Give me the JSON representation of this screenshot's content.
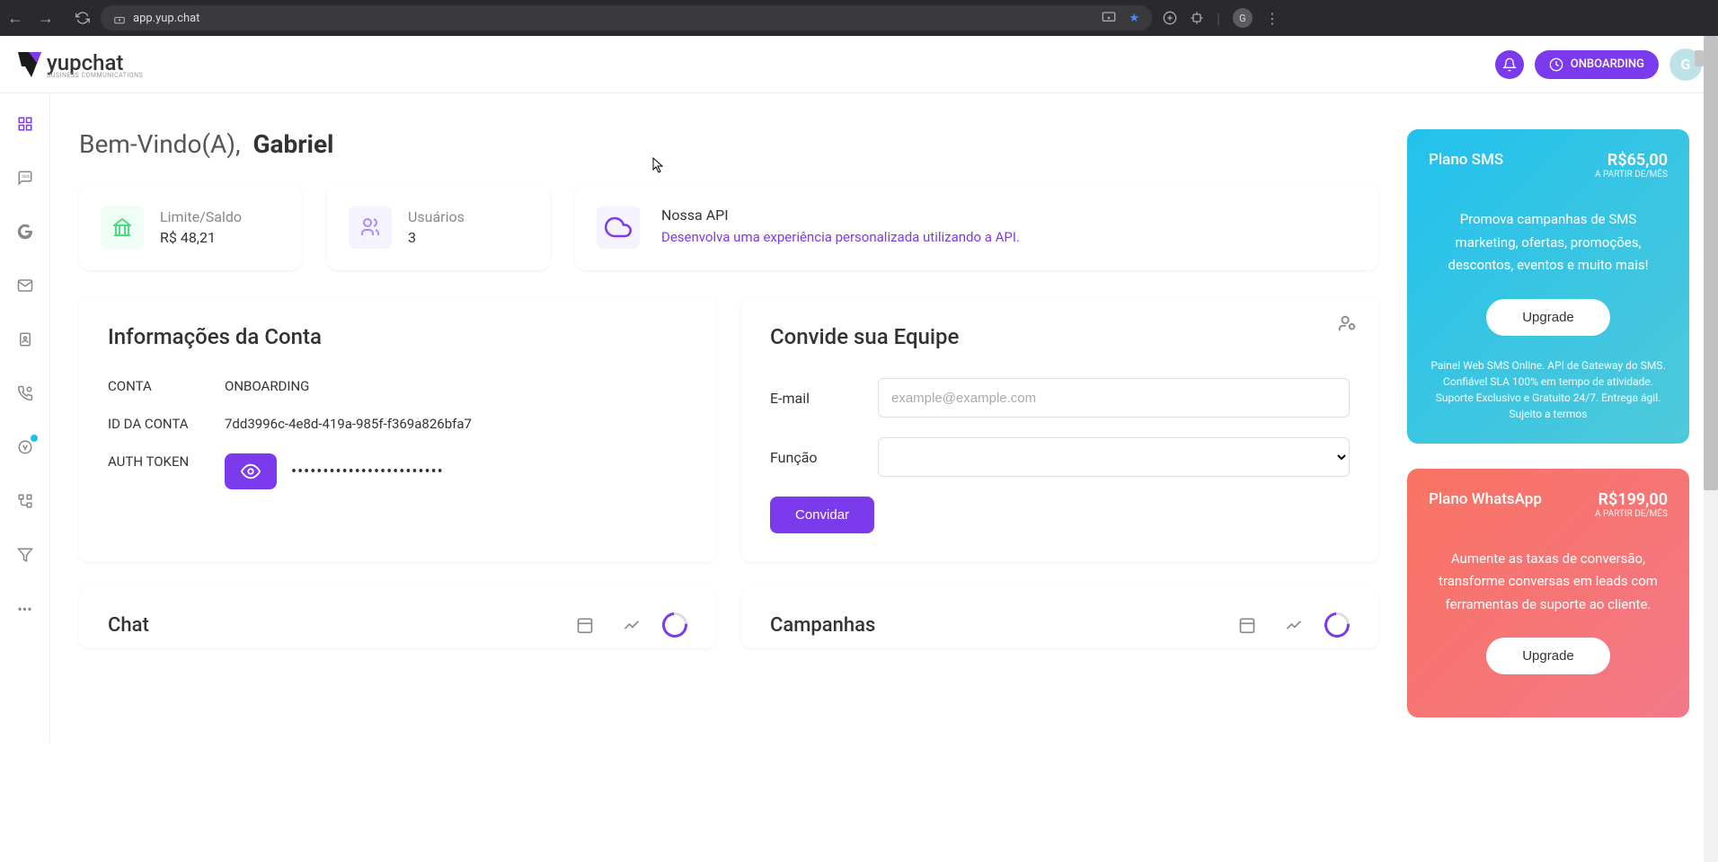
{
  "browser": {
    "url": "app.yup.chat",
    "profile_letter": "G"
  },
  "header": {
    "brand": "yupchat",
    "brand_sub": "BUSINESS COMMUNICATIONS",
    "onboarding_label": "ONBOARDING",
    "avatar_letter": "G"
  },
  "welcome": {
    "greeting": "Bem-Vindo(A),",
    "name": "Gabriel"
  },
  "stats": {
    "balance_label": "Limite/Saldo",
    "balance_value": "R$ 48,21",
    "users_label": "Usuários",
    "users_value": "3",
    "api_title": "Nossa API",
    "api_desc": "Desenvolva uma experiência personalizada utilizando a API."
  },
  "account_info": {
    "title": "Informações da Conta",
    "label_account": "CONTA",
    "value_account": "ONBOARDING",
    "label_id": "ID DA CONTA",
    "value_id": "7dd3996c-4e8d-419a-985f-f369a826bfa7",
    "label_token": "AUTH TOKEN",
    "value_token_masked": "••••••••••••••••••••••••"
  },
  "team": {
    "title": "Convide sua Equipe",
    "label_email": "E-mail",
    "placeholder_email": "example@example.com",
    "label_role": "Função",
    "invite_label": "Convidar"
  },
  "plans": {
    "sms": {
      "name": "Plano SMS",
      "price": "R$65,00",
      "per": "A PARTIR DE/MÊS",
      "desc": "Promova campanhas de SMS marketing, ofertas, promoções, descontos, eventos e muito mais!",
      "upgrade": "Upgrade",
      "fine": "Painel Web SMS Online. API de Gateway do SMS. Confiável SLA 100% em tempo de atividade. Suporte Exclusivo e Gratuito 24/7. Entrega ágil. Sujeito a termos"
    },
    "wa": {
      "name": "Plano WhatsApp",
      "price": "R$199,00",
      "per": "A PARTIR DE/MÊS",
      "desc": "Aumente as taxas de conversão, transforme conversas em leads com ferramentas de suporte ao cliente.",
      "upgrade": "Upgrade"
    }
  },
  "sections": {
    "chat_title": "Chat",
    "campaigns_title": "Campanhas"
  }
}
